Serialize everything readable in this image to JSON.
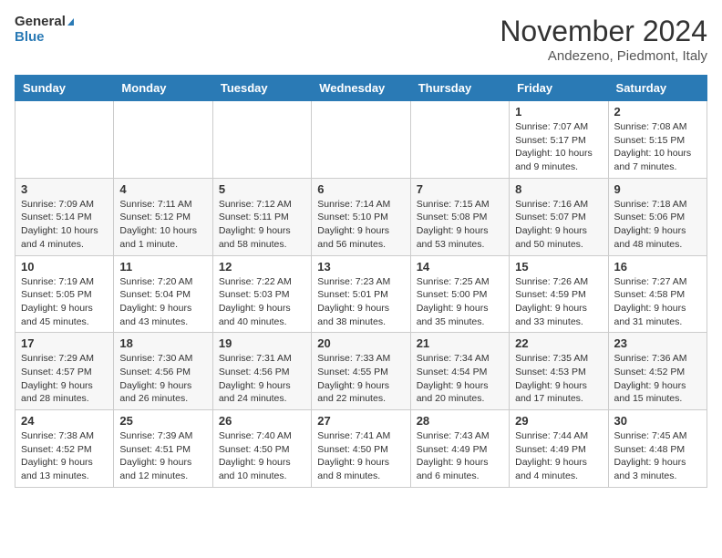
{
  "header": {
    "logo_line1": "General",
    "logo_line2": "Blue",
    "month": "November 2024",
    "location": "Andezeno, Piedmont, Italy"
  },
  "weekdays": [
    "Sunday",
    "Monday",
    "Tuesday",
    "Wednesday",
    "Thursday",
    "Friday",
    "Saturday"
  ],
  "weeks": [
    [
      {
        "day": "",
        "info": ""
      },
      {
        "day": "",
        "info": ""
      },
      {
        "day": "",
        "info": ""
      },
      {
        "day": "",
        "info": ""
      },
      {
        "day": "",
        "info": ""
      },
      {
        "day": "1",
        "info": "Sunrise: 7:07 AM\nSunset: 5:17 PM\nDaylight: 10 hours and 9 minutes."
      },
      {
        "day": "2",
        "info": "Sunrise: 7:08 AM\nSunset: 5:15 PM\nDaylight: 10 hours and 7 minutes."
      }
    ],
    [
      {
        "day": "3",
        "info": "Sunrise: 7:09 AM\nSunset: 5:14 PM\nDaylight: 10 hours and 4 minutes."
      },
      {
        "day": "4",
        "info": "Sunrise: 7:11 AM\nSunset: 5:12 PM\nDaylight: 10 hours and 1 minute."
      },
      {
        "day": "5",
        "info": "Sunrise: 7:12 AM\nSunset: 5:11 PM\nDaylight: 9 hours and 58 minutes."
      },
      {
        "day": "6",
        "info": "Sunrise: 7:14 AM\nSunset: 5:10 PM\nDaylight: 9 hours and 56 minutes."
      },
      {
        "day": "7",
        "info": "Sunrise: 7:15 AM\nSunset: 5:08 PM\nDaylight: 9 hours and 53 minutes."
      },
      {
        "day": "8",
        "info": "Sunrise: 7:16 AM\nSunset: 5:07 PM\nDaylight: 9 hours and 50 minutes."
      },
      {
        "day": "9",
        "info": "Sunrise: 7:18 AM\nSunset: 5:06 PM\nDaylight: 9 hours and 48 minutes."
      }
    ],
    [
      {
        "day": "10",
        "info": "Sunrise: 7:19 AM\nSunset: 5:05 PM\nDaylight: 9 hours and 45 minutes."
      },
      {
        "day": "11",
        "info": "Sunrise: 7:20 AM\nSunset: 5:04 PM\nDaylight: 9 hours and 43 minutes."
      },
      {
        "day": "12",
        "info": "Sunrise: 7:22 AM\nSunset: 5:03 PM\nDaylight: 9 hours and 40 minutes."
      },
      {
        "day": "13",
        "info": "Sunrise: 7:23 AM\nSunset: 5:01 PM\nDaylight: 9 hours and 38 minutes."
      },
      {
        "day": "14",
        "info": "Sunrise: 7:25 AM\nSunset: 5:00 PM\nDaylight: 9 hours and 35 minutes."
      },
      {
        "day": "15",
        "info": "Sunrise: 7:26 AM\nSunset: 4:59 PM\nDaylight: 9 hours and 33 minutes."
      },
      {
        "day": "16",
        "info": "Sunrise: 7:27 AM\nSunset: 4:58 PM\nDaylight: 9 hours and 31 minutes."
      }
    ],
    [
      {
        "day": "17",
        "info": "Sunrise: 7:29 AM\nSunset: 4:57 PM\nDaylight: 9 hours and 28 minutes."
      },
      {
        "day": "18",
        "info": "Sunrise: 7:30 AM\nSunset: 4:56 PM\nDaylight: 9 hours and 26 minutes."
      },
      {
        "day": "19",
        "info": "Sunrise: 7:31 AM\nSunset: 4:56 PM\nDaylight: 9 hours and 24 minutes."
      },
      {
        "day": "20",
        "info": "Sunrise: 7:33 AM\nSunset: 4:55 PM\nDaylight: 9 hours and 22 minutes."
      },
      {
        "day": "21",
        "info": "Sunrise: 7:34 AM\nSunset: 4:54 PM\nDaylight: 9 hours and 20 minutes."
      },
      {
        "day": "22",
        "info": "Sunrise: 7:35 AM\nSunset: 4:53 PM\nDaylight: 9 hours and 17 minutes."
      },
      {
        "day": "23",
        "info": "Sunrise: 7:36 AM\nSunset: 4:52 PM\nDaylight: 9 hours and 15 minutes."
      }
    ],
    [
      {
        "day": "24",
        "info": "Sunrise: 7:38 AM\nSunset: 4:52 PM\nDaylight: 9 hours and 13 minutes."
      },
      {
        "day": "25",
        "info": "Sunrise: 7:39 AM\nSunset: 4:51 PM\nDaylight: 9 hours and 12 minutes."
      },
      {
        "day": "26",
        "info": "Sunrise: 7:40 AM\nSunset: 4:50 PM\nDaylight: 9 hours and 10 minutes."
      },
      {
        "day": "27",
        "info": "Sunrise: 7:41 AM\nSunset: 4:50 PM\nDaylight: 9 hours and 8 minutes."
      },
      {
        "day": "28",
        "info": "Sunrise: 7:43 AM\nSunset: 4:49 PM\nDaylight: 9 hours and 6 minutes."
      },
      {
        "day": "29",
        "info": "Sunrise: 7:44 AM\nSunset: 4:49 PM\nDaylight: 9 hours and 4 minutes."
      },
      {
        "day": "30",
        "info": "Sunrise: 7:45 AM\nSunset: 4:48 PM\nDaylight: 9 hours and 3 minutes."
      }
    ]
  ]
}
